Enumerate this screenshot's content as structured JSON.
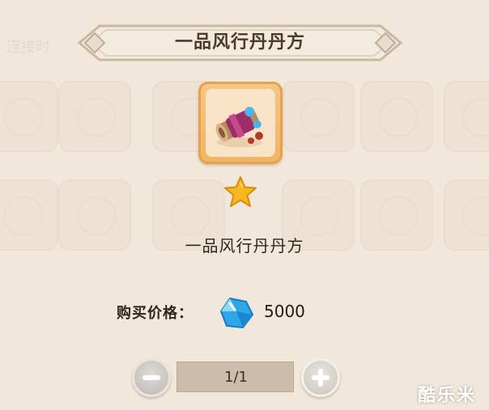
{
  "background": {
    "faded_label": "连接时"
  },
  "dialog": {
    "title": "一品风行丹丹方",
    "item": {
      "icon": "scroll-item-icon",
      "rarity_stars": 1,
      "name": "一品风行丹丹方"
    },
    "price": {
      "label": "购买价格：",
      "currency_icon": "blue-gem-icon",
      "value": "5000"
    },
    "quantity": {
      "display": "1/1",
      "minus_icon": "minus-icon",
      "plus_icon": "plus-icon"
    }
  },
  "watermark": "酷乐米",
  "colors": {
    "ribbon": "#f4ebdf",
    "ribbon_border": "#c9b8a2",
    "item_frame": "#f0b465",
    "gem": "#2fa6e8",
    "star": "#f7b81f",
    "qty_box": "#cdbcaa"
  }
}
